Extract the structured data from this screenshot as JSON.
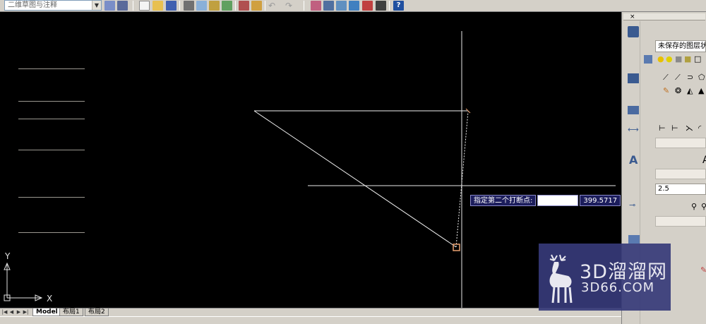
{
  "toolbar": {
    "workspace": "二维草图与注释"
  },
  "canvas": {
    "background": "#000000",
    "ucs_y_label": "Y",
    "ucs_x_label": "X"
  },
  "dynamic_input": {
    "prompt": "指定第二个打断点:",
    "field_value": "",
    "distance": "399.5717"
  },
  "layout_tabs": {
    "items": [
      {
        "label": "Model",
        "active": true
      },
      {
        "label": "布局1",
        "active": false
      },
      {
        "label": "布局2",
        "active": false
      }
    ]
  },
  "palette": {
    "layer_state": "未保存的图层状态",
    "text_height": "2.5",
    "text_style_glyph": "A"
  },
  "watermark": {
    "brand": "3D溜溜网",
    "domain": "3D66.COM"
  },
  "colors": {
    "prompt_bg": "#1c1d5c",
    "snap_marker": "#e8a070",
    "watermark_bg": "#363a78"
  }
}
